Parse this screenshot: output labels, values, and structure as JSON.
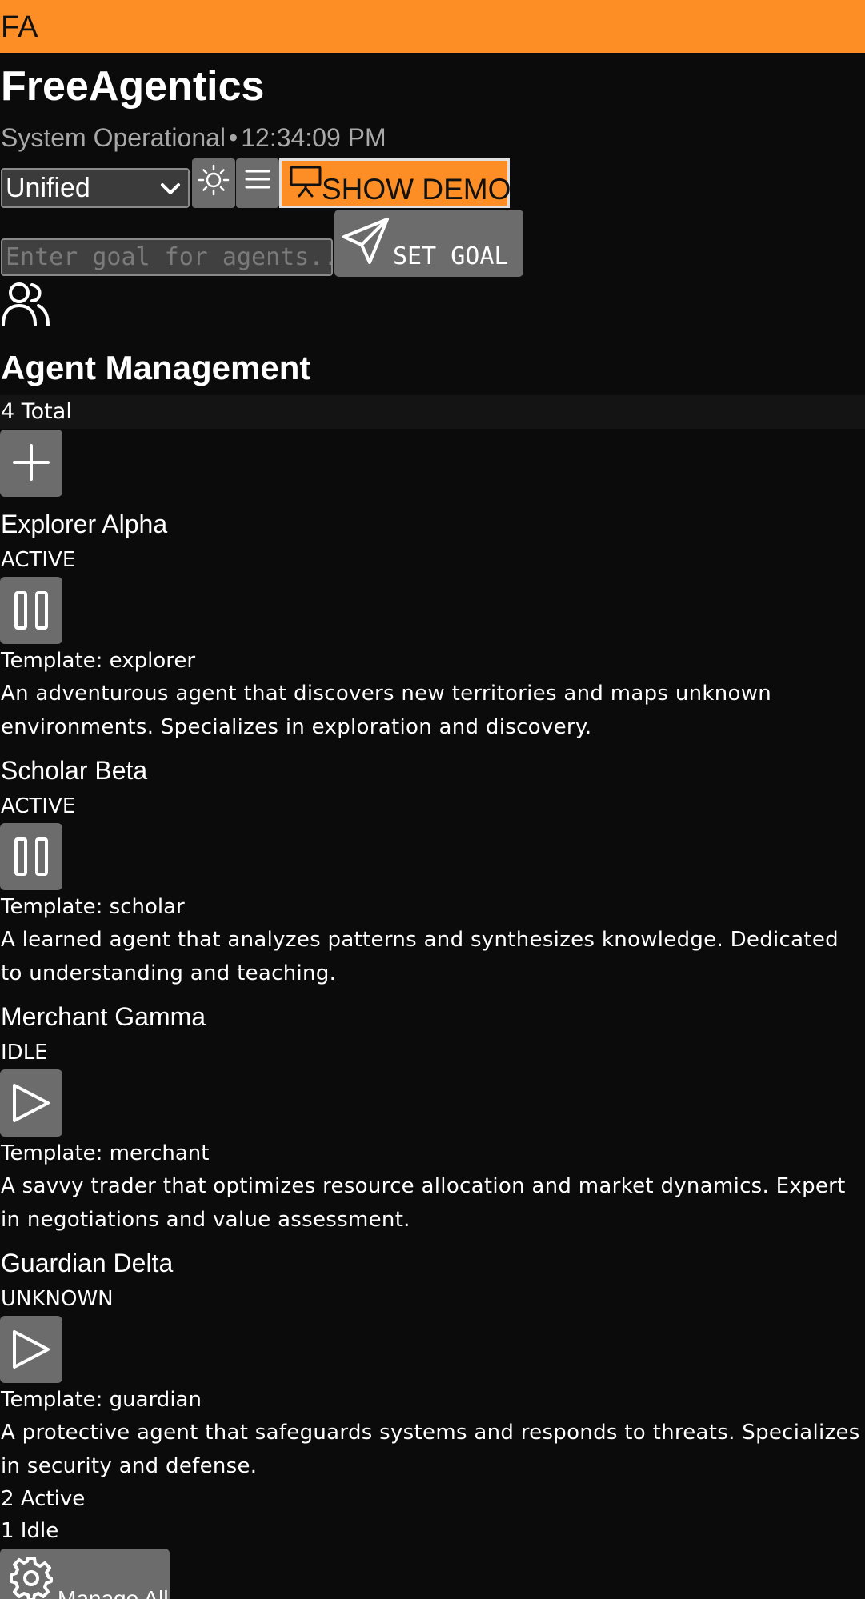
{
  "top_bar": {
    "logo_text": "FA"
  },
  "header": {
    "title": "FreeAgentics",
    "status_text": "System Operational",
    "separator": "•",
    "time": "12:34:09 PM"
  },
  "toolbar": {
    "view_select_value": "Unified",
    "theme_icon": "sun-icon",
    "menu_icon": "menu-icon",
    "demo_label": "SHOW DEMO",
    "demo_icon": "presentation-icon"
  },
  "goal": {
    "placeholder": "Enter goal for agents...",
    "set_goal_label": "SET GOAL",
    "send_icon": "send-icon"
  },
  "agent_panel": {
    "icon": "users-icon",
    "title": "Agent Management",
    "total_label": "4 Total",
    "add_icon": "plus-icon",
    "agents": [
      {
        "name": "Explorer Alpha",
        "status": "ACTIVE",
        "action_icon": "pause-icon",
        "template": "Template: explorer",
        "description": "An adventurous agent that discovers new territories and maps unknown environments. Specializes in exploration and discovery."
      },
      {
        "name": "Scholar Beta",
        "status": "ACTIVE",
        "action_icon": "pause-icon",
        "template": "Template: scholar",
        "description": "A learned agent that analyzes patterns and synthesizes knowledge. Dedicated to understanding and teaching."
      },
      {
        "name": "Merchant Gamma",
        "status": "IDLE",
        "action_icon": "play-icon",
        "template": "Template: merchant",
        "description": "A savvy trader that optimizes resource allocation and market dynamics. Expert in negotiations and value assessment."
      },
      {
        "name": "Guardian Delta",
        "status": "UNKNOWN",
        "action_icon": "play-icon",
        "template": "Template: guardian",
        "description": "A protective agent that safeguards systems and responds to threats. Specializes in security and defense."
      }
    ],
    "active_count": "2 Active",
    "idle_count": "1 Idle",
    "manage_label": "Manage All",
    "manage_icon": "gear-icon"
  },
  "colors": {
    "accent": "#fd8e25",
    "background": "#0b0b0b",
    "button": "#6c6c6c",
    "muted_text": "#a8a8a8"
  }
}
